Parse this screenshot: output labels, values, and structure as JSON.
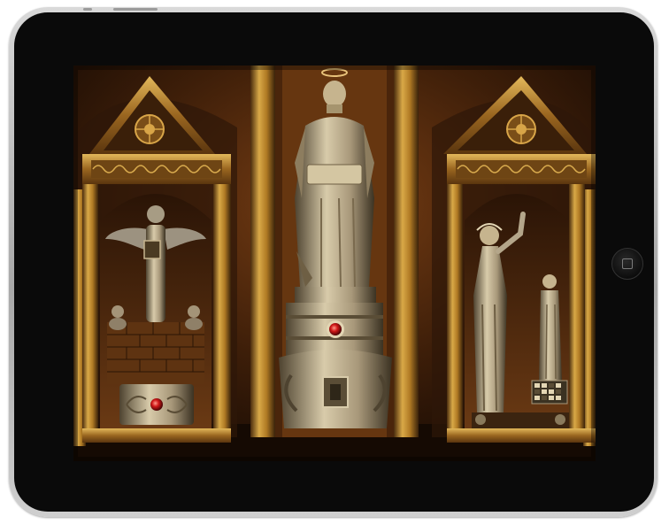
{
  "device": {
    "type": "tablet",
    "frame_color": "#b8b8b8",
    "bezel_color": "#0a0a0a",
    "home_button_icon": "home-square-icon"
  },
  "scene": {
    "palette": {
      "wall_dark": "#1d0f05",
      "wall_warm": "#6a3512",
      "gold": "#c8962f",
      "bronze": "#8a5a22",
      "stone": "#b4a68a",
      "jewel": "#c81818"
    },
    "elements": [
      "left-shrine-angel-statue",
      "center-saint-statue",
      "right-shrine-two-statues",
      "center-pedestal-red-jewel",
      "left-altar-red-jewel",
      "right-altar-tile-puzzle"
    ]
  }
}
